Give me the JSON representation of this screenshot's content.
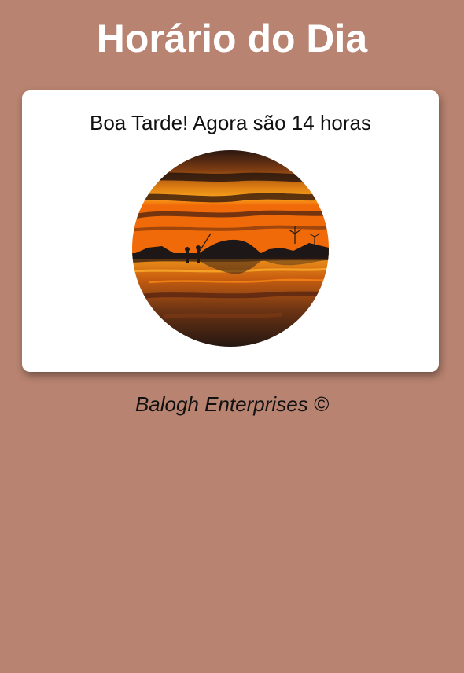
{
  "page": {
    "title": "Horário do Dia"
  },
  "card": {
    "greeting": "Boa Tarde! Agora são 14 horas",
    "image": {
      "subject": "sunset-over-beach",
      "shape": "circle"
    }
  },
  "footer": {
    "text": "Balogh Enterprises ©"
  },
  "colors": {
    "background": "#b88370",
    "card": "#ffffff",
    "title": "#ffffff",
    "text": "#111111"
  }
}
